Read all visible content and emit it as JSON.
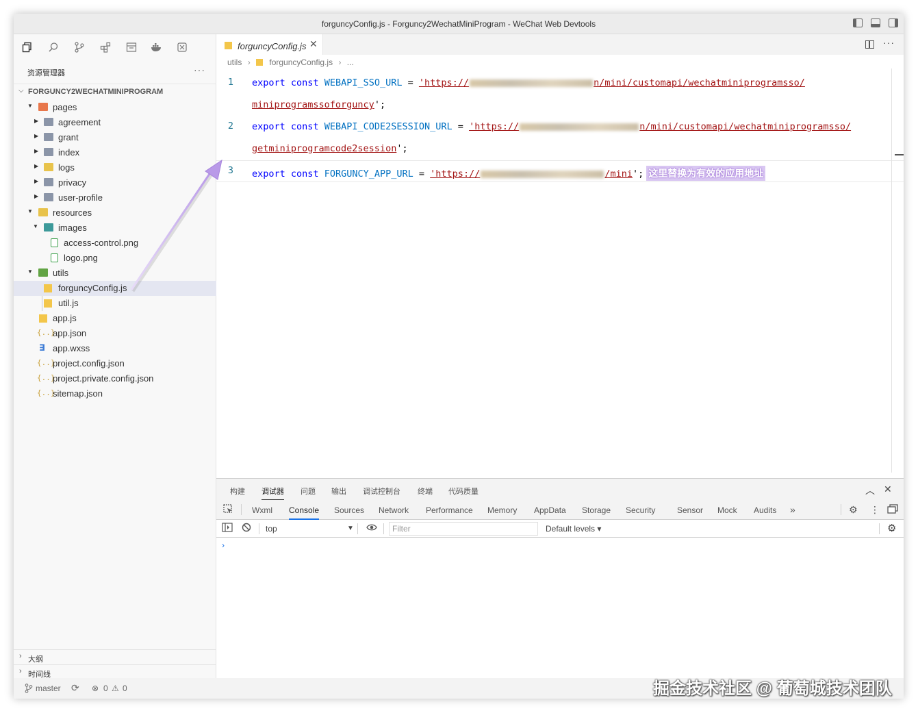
{
  "window": {
    "title": "forguncyConfig.js - Forguncy2WechatMiniProgram - WeChat Web Devtools"
  },
  "activity_bar": {
    "icons": [
      "files-icon",
      "search-icon",
      "source-control-icon",
      "extensions-icon",
      "storage-icon",
      "docker-icon",
      "remote-icon"
    ]
  },
  "explorer": {
    "header": "资源管理器",
    "more": "···",
    "project": "FORGUNCY2WECHATMINIPROGRAM",
    "tree": [
      {
        "name": "pages",
        "type": "folder-pages",
        "expanded": true
      },
      {
        "name": "agreement",
        "type": "folder",
        "expanded": false
      },
      {
        "name": "grant",
        "type": "folder",
        "expanded": false
      },
      {
        "name": "index",
        "type": "folder",
        "expanded": false
      },
      {
        "name": "logs",
        "type": "folder-yellow",
        "expanded": false
      },
      {
        "name": "privacy",
        "type": "folder",
        "expanded": false
      },
      {
        "name": "user-profile",
        "type": "folder",
        "expanded": false
      },
      {
        "name": "resources",
        "type": "folder-yellow",
        "expanded": true
      },
      {
        "name": "images",
        "type": "folder-teal",
        "expanded": true
      },
      {
        "name": "access-control.png",
        "type": "image"
      },
      {
        "name": "logo.png",
        "type": "image"
      },
      {
        "name": "utils",
        "type": "folder-green",
        "expanded": true
      },
      {
        "name": "forguncyConfig.js",
        "type": "js",
        "selected": true
      },
      {
        "name": "util.js",
        "type": "js"
      },
      {
        "name": "app.js",
        "type": "js"
      },
      {
        "name": "app.json",
        "type": "json"
      },
      {
        "name": "app.wxss",
        "type": "wxss"
      },
      {
        "name": "project.config.json",
        "type": "json"
      },
      {
        "name": "project.private.config.json",
        "type": "json"
      },
      {
        "name": "sitemap.json",
        "type": "json"
      }
    ],
    "outline": "大纲",
    "timeline": "时间线"
  },
  "statusbar": {
    "branch": "master",
    "errors": "0",
    "warnings": "0"
  },
  "editor": {
    "tab": "forguncyConfig.js",
    "breadcrumb": {
      "folder": "utils",
      "file": "forguncyConfig.js",
      "more": "..."
    },
    "lines": [
      {
        "num": "1",
        "kw1": "export",
        "kw2": "const",
        "name": "WEBAPI_SSO_URL",
        "eq": "=",
        "str_start": "'https://",
        "str_end": "n/mini/customapi/wechatminiprogramsso/",
        "str_wrap": "miniprogramssoforguncy",
        "tail": "';"
      },
      {
        "num": "2",
        "kw1": "export",
        "kw2": "const",
        "name": "WEBAPI_CODE2SESSION_URL",
        "eq": "=",
        "str_start": "'https://",
        "str_end": "n/mini/customapi/wechatminiprogramsso/",
        "str_wrap": "getminiprogramcode2session",
        "tail": "';"
      },
      {
        "num": "3",
        "kw1": "export",
        "kw2": "const",
        "name": "FORGUNCY_APP_URL",
        "eq": "=",
        "str_start": "'https://",
        "str_end": "/mini",
        "tail": "';",
        "callout": "这里替换为有效的应用地址"
      }
    ]
  },
  "devtools": {
    "top_tabs": [
      "构建",
      "调试器",
      "问题",
      "输出",
      "调试控制台",
      "终端",
      "代码质量"
    ],
    "active_top_tab": "调试器",
    "panel_tabs": [
      "Wxml",
      "Console",
      "Sources",
      "Network",
      "Performance",
      "Memory",
      "AppData",
      "Storage",
      "Security",
      "Sensor",
      "Mock",
      "Audits"
    ],
    "active_panel_tab": "Console",
    "overflow": "»",
    "context": "top",
    "filter_placeholder": "Filter",
    "levels": "Default levels ▾",
    "prompt": "›"
  },
  "watermark": "掘金技术社区 @ 葡萄城技术团队"
}
